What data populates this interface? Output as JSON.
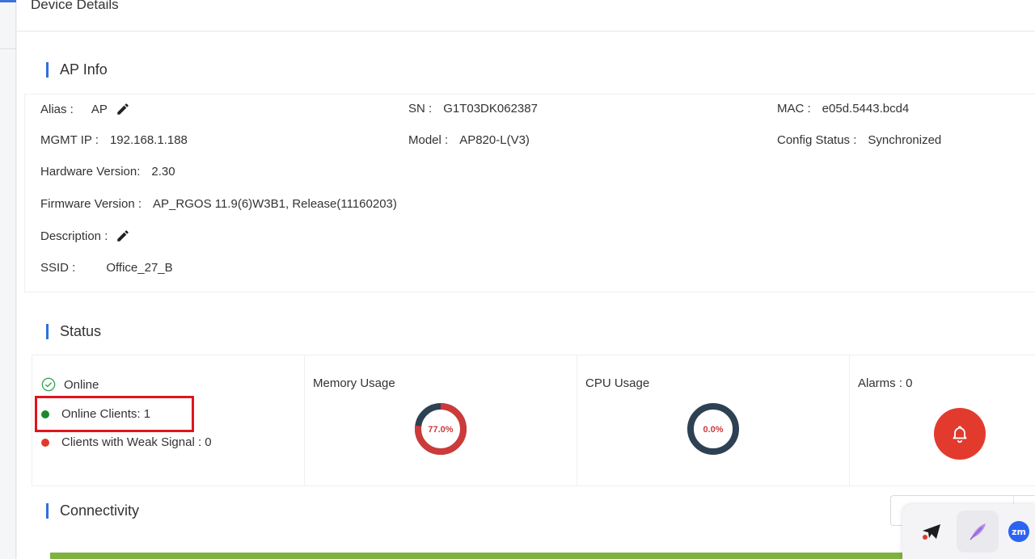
{
  "drawer": {
    "title": "Device Details"
  },
  "ap_info": {
    "section_title": "AP Info",
    "alias_label": "Alias :",
    "alias_value": "AP",
    "sn_label": "SN :",
    "sn_value": "G1T03DK062387",
    "mac_label": "MAC :",
    "mac_value": "e05d.5443.bcd4",
    "mgmt_ip_label": "MGMT IP :",
    "mgmt_ip_value": "192.168.1.188",
    "model_label": "Model :",
    "model_value": "AP820-L(V3)",
    "config_status_label": "Config Status :",
    "config_status_value": "Synchronized",
    "hardware_label": "Hardware Version:",
    "hardware_value": "2.30",
    "firmware_label": "Firmware Version :",
    "firmware_value": "AP_RGOS 11.9(6)W3B1, Release(11160203)",
    "description_label": "Description :",
    "ssid_label": "SSID :",
    "ssid_value": "Office_27_B"
  },
  "status": {
    "section_title": "Status",
    "online_label": "Online",
    "online_clients": "Online Clients: 1",
    "weak_signal": "Clients with Weak Signal : 0",
    "memory_title": "Memory Usage",
    "memory_value": "77.0%",
    "memory_fraction": 0.77,
    "cpu_title": "CPU Usage",
    "cpu_value": "0.0%",
    "cpu_fraction": 0.0,
    "alarms_title": "Alarms : 0"
  },
  "connectivity": {
    "section_title": "Connectivity"
  },
  "colors": {
    "accent": "#2f6fde",
    "online_green": "#1a8a2e",
    "weak_red": "#e0392b",
    "memory_used": "#cc3a3a",
    "donut_dark": "#2e4153",
    "alarm_red": "#e23b2e",
    "highlight": "#e0141c"
  },
  "tray": {
    "zoom_badge": "zm"
  }
}
